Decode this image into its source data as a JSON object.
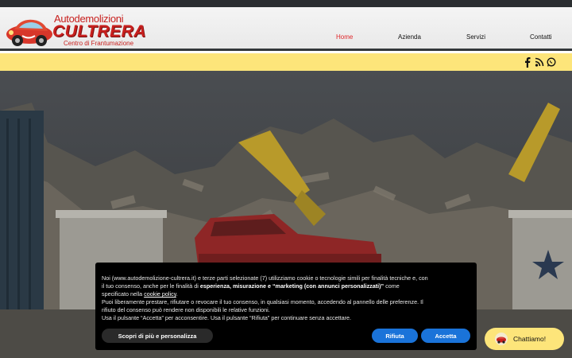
{
  "logo": {
    "line1": "Autodemolizioni",
    "line2": "CULTRERA",
    "line3": "Centro di Frantumazione"
  },
  "nav": {
    "items": [
      "Home",
      "Azienda",
      "Servizi",
      "Contatti"
    ],
    "active": "Home"
  },
  "social": [
    "facebook-icon",
    "rss-icon",
    "whatsapp-icon"
  ],
  "cookie": {
    "line1_pre": "Noi (www.autodemolizione-cultrera.it) e terze parti selezionate (7) utilizziamo cookie o tecnologie simili per finalità tecniche e, con",
    "line2_pre": "il tuo consenso, anche per le finalità di ",
    "line2_bold": "esperienza, misurazione e “marketing (con annunci personalizzati)”",
    "line2_post": " come",
    "line3_pre": "specificato nella ",
    "line3_link": "cookie policy",
    "line3_post": ".",
    "line4": "Puoi liberamente prestare, rifiutare o revocare il tuo consenso, in qualsiasi momento, accedendo al pannello delle preferenze. Il",
    "line5": "rifiuto del consenso può rendere non disponibili le relative funzioni.",
    "line6": "Usa il pulsante “Accetta” per acconsentire. Usa il pulsante “Rifiuta” per continuare senza accettare.",
    "more_button": "Scopri di più e personalizza",
    "reject_button": "Rifiuta",
    "accept_button": "Accetta"
  },
  "chat": {
    "label": "Chattiamo!"
  },
  "colors": {
    "brand_red": "#c8201e",
    "accent_yellow": "#fde57a",
    "button_blue": "#1a73d9",
    "dark_bar": "#2b2e31"
  }
}
